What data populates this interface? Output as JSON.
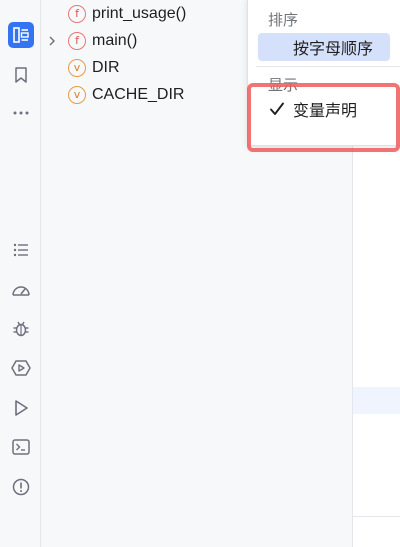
{
  "activity_bar": {
    "items": [
      {
        "name": "structure-icon",
        "active": true
      },
      {
        "name": "bookmarks-icon",
        "active": false
      },
      {
        "name": "more-icon",
        "active": false
      },
      {
        "name": "todo-list-icon",
        "active": false
      },
      {
        "name": "profiler-icon",
        "active": false
      },
      {
        "name": "debug-icon",
        "active": false
      },
      {
        "name": "services-icon",
        "active": false
      },
      {
        "name": "run-icon",
        "active": false
      },
      {
        "name": "terminal-icon",
        "active": false
      },
      {
        "name": "problems-icon",
        "active": false
      }
    ]
  },
  "outline": {
    "items": [
      {
        "kind": "f",
        "label": "print_usage()",
        "expandable": false
      },
      {
        "kind": "f",
        "label": "main()",
        "expandable": true
      },
      {
        "kind": "v",
        "label": "DIR",
        "expandable": false
      },
      {
        "kind": "v",
        "label": "CACHE_DIR",
        "expandable": false
      }
    ]
  },
  "popup": {
    "sort_section": "排序",
    "sort_alpha": "按字母顺序",
    "show_section": "显示",
    "show_var_decl": "变量声明"
  },
  "colors": {
    "accent": "#3574f0",
    "func_badge": "#d9534f",
    "var_badge": "#d9822b",
    "selection": "#d5e1fb",
    "annotation": "#ee5a5a"
  }
}
